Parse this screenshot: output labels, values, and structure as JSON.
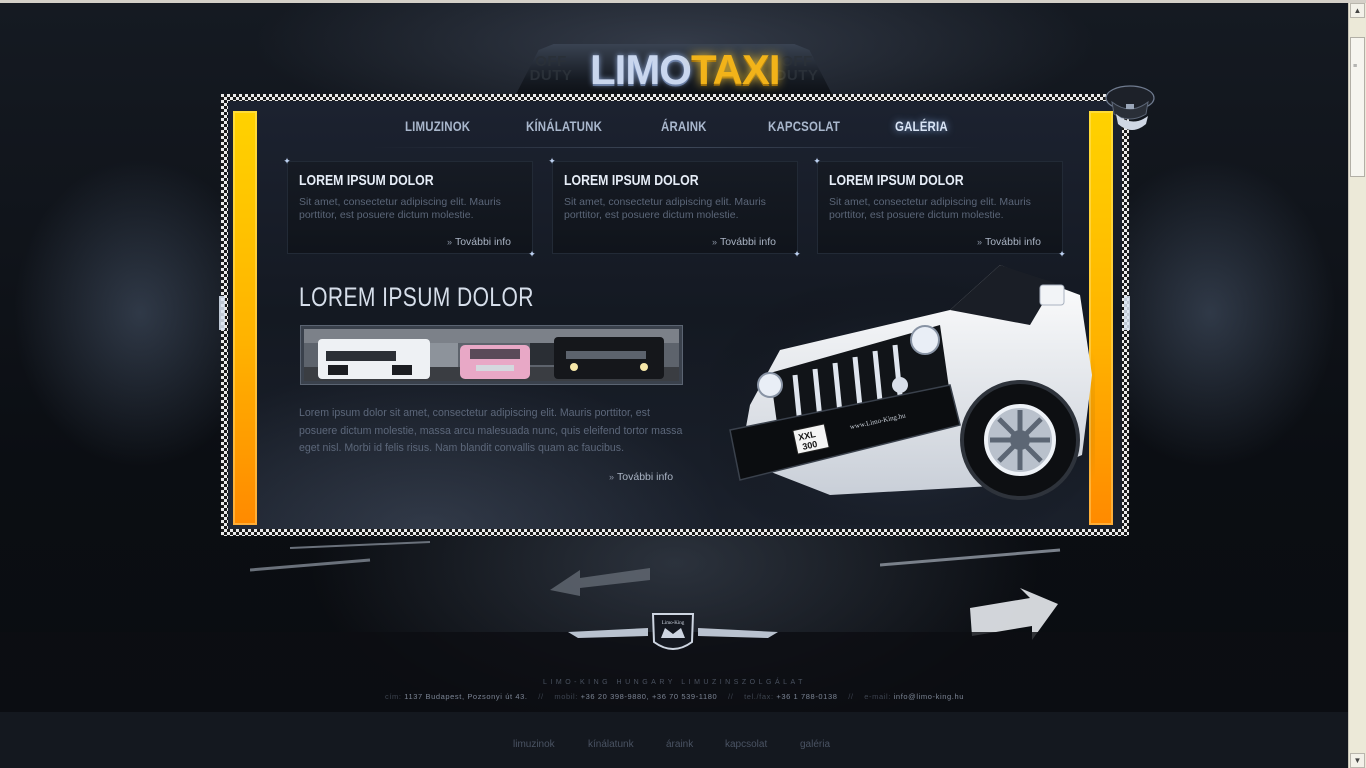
{
  "logo": {
    "part1": "LIMO",
    "part2": "TAXI",
    "sign_left": "OFF DUTY",
    "sign_right": "OFF DUTY"
  },
  "nav": [
    {
      "label": "LIMUZINOK"
    },
    {
      "label": "KÍNÁLATUNK"
    },
    {
      "label": "ÁRAINK"
    },
    {
      "label": "KAPCSOLAT"
    },
    {
      "label": "GALÉRIA",
      "active": true
    }
  ],
  "boxes": [
    {
      "title": "LOREM IPSUM DOLOR",
      "text": "Sit amet, consectetur adipiscing elit. Mauris porttitor, est posuere dictum molestie.",
      "more": "További info"
    },
    {
      "title": "LOREM IPSUM DOLOR",
      "text": "Sit amet, consectetur adipiscing elit. Mauris porttitor, est posuere dictum molestie.",
      "more": "További info"
    },
    {
      "title": "LOREM IPSUM DOLOR",
      "text": "Sit amet, consectetur adipiscing elit. Mauris porttitor, est posuere dictum molestie.",
      "more": "További info"
    }
  ],
  "main": {
    "title": "LOREM IPSUM DOLOR",
    "text": "Lorem ipsum dolor sit amet, consectetur adipiscing elit. Mauris porttitor, est posuere dictum molestie, massa arcu malesuada nunc, quis eleifend tortor massa eget nisl. Morbi id felis risus. Nam blandit convallis quam ac faucibus.",
    "more": "További info"
  },
  "hummer": {
    "plate_line1": "XXL",
    "plate_line2": "300",
    "badge": "www.Limo-King.hu"
  },
  "emblem": {
    "text": "Limo-King"
  },
  "footer": {
    "company": "Limo-King Hungary limuzinszolgálat",
    "address_label": "cím:",
    "address": "1137 Budapest, Pozsonyi út 43.",
    "mobile_label": "mobil:",
    "mobile": "+36 20 398-9880, +36 70 539-1180",
    "tel_label": "tel./fax:",
    "tel": "+36 1 788-0138",
    "email_label": "e-mail:",
    "email": "info@limo-king.hu",
    "separator": "//"
  },
  "bottom_nav": [
    {
      "label": "limuzinok"
    },
    {
      "label": "kínálatunk"
    },
    {
      "label": "áraink"
    },
    {
      "label": "kapcsolat"
    },
    {
      "label": "galéria"
    }
  ],
  "colors": {
    "accent_yellow": "#ffc400",
    "accent_orange": "#ff8a00",
    "logo_gold": "#f2b319",
    "background": "#0c0f14"
  },
  "icons": {
    "more_arrow": "double-chevron-right-icon",
    "logo_cap": "chauffeur-cap-icon"
  }
}
